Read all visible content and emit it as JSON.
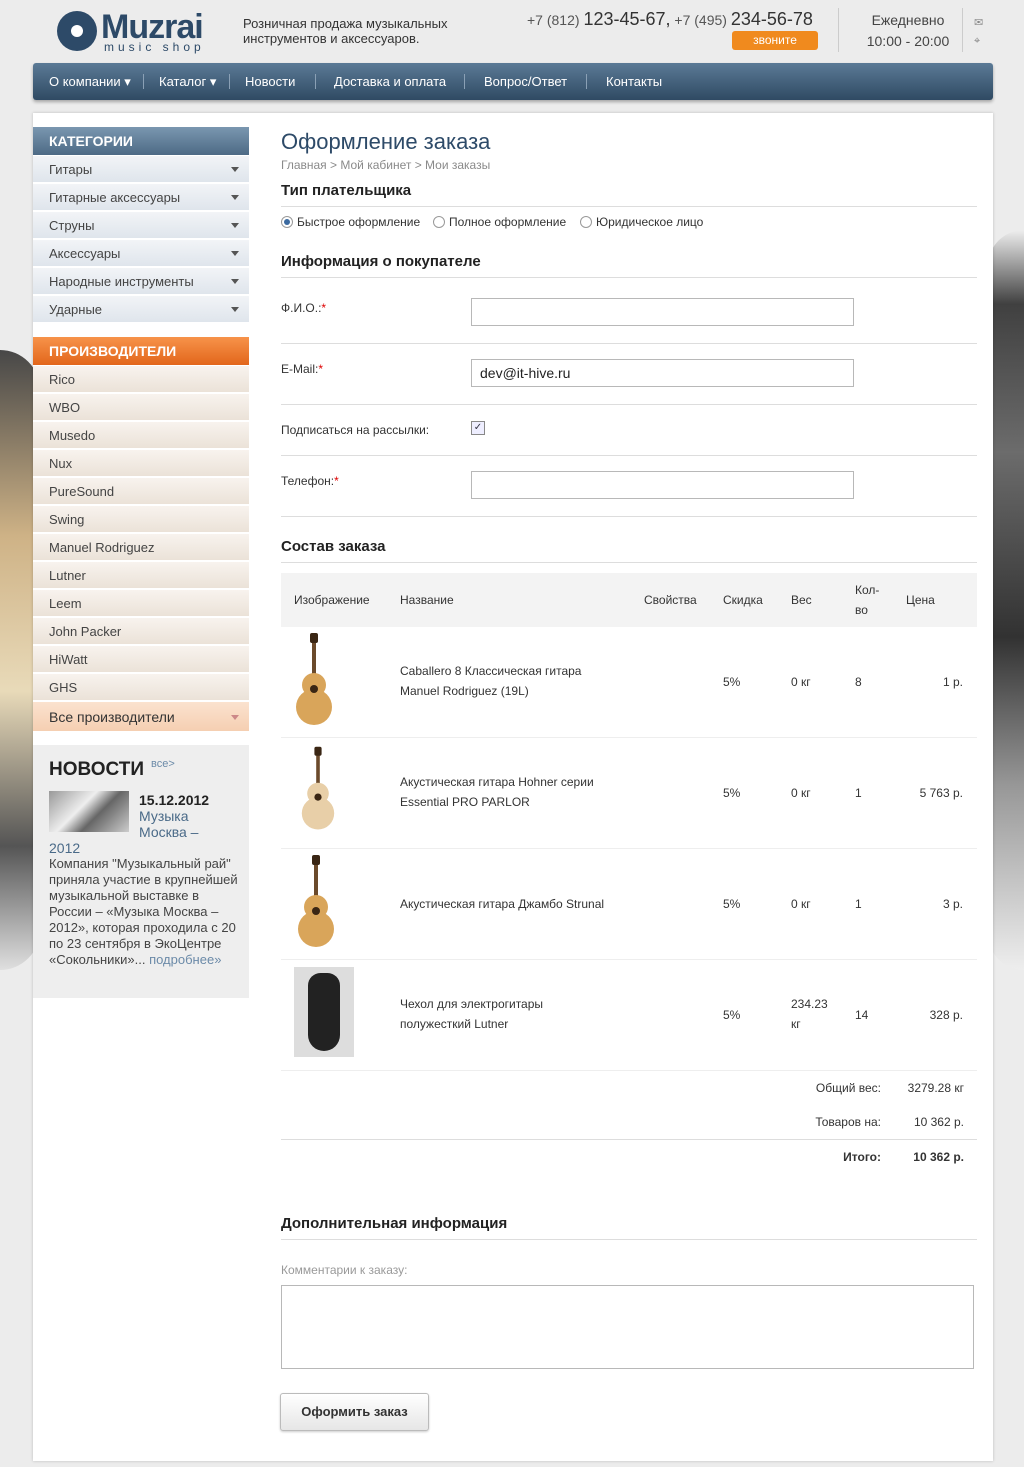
{
  "header": {
    "brand": "Muzrai",
    "brand_sub": "music shop",
    "tagline": "Розничная продажа музыкальных инструментов и аксессуаров.",
    "phone1_prefix": "+7 (812)",
    "phone1": "123-45-67,",
    "phone2_prefix": "+7 (495)",
    "phone2": "234-56-78",
    "call_label": "звоните",
    "hours_title": "Ежедневно",
    "hours_value": "10:00 - 20:00",
    "mail_icon": "✉",
    "map_icon": "⌖"
  },
  "nav": [
    {
      "label": "О компании ▾"
    },
    {
      "label": "Каталог ▾"
    },
    {
      "label": "Новости"
    },
    {
      "label": "Доставка и оплата"
    },
    {
      "label": "Вопрос/Ответ"
    },
    {
      "label": "Контакты"
    }
  ],
  "sidebar": {
    "categories_title": "КАТЕГОРИИ",
    "categories": [
      "Гитары",
      "Гитарные аксессуары",
      "Струны",
      "Аксессуары",
      "Народные инструменты",
      "Ударные"
    ],
    "manufacturers_title": "ПРОИЗВОДИТЕЛИ",
    "manufacturers": [
      "Rico",
      "WBO",
      "Musedo",
      "Nux",
      "PureSound",
      "Swing",
      "Manuel Rodriguez",
      "Lutner",
      "Leem",
      "John Packer",
      "HiWatt",
      "GHS"
    ],
    "all_manufacturers": "Все производители"
  },
  "news": {
    "title": "НОВОСТИ",
    "all": "все>",
    "date": "15.12.2012",
    "headline_part1": "Музыка Москва –",
    "headline_part2": "2012",
    "text": "Компания \"Музыкальный рай\" приняла участие в крупнейшей музыкальной выставке в России – «Музыка Москва – 2012», которая проходила с 20 по 23 сентября в ЭкоЦентре «Сокольники»...",
    "more": "подробнее»"
  },
  "page": {
    "title": "Оформление заказа",
    "breadcrumbs": "Главная > Мой кабинет > Мои заказы"
  },
  "payer": {
    "title": "Тип плательщика",
    "options": [
      "Быстрое оформление",
      "Полное оформление",
      "Юридическое лицо"
    ],
    "selected": "Быстрое оформление"
  },
  "buyer": {
    "title": "Информация о покупателе",
    "fio_label": "Ф.И.О.:",
    "fio_value": "",
    "email_label": "E-Mail:",
    "email_value": "dev@it-hive.ru",
    "subscribe_label": "Подписаться на рассылки:",
    "subscribe_checked": true,
    "phone_label": "Телефон:",
    "phone_value": "",
    "required_mark": "*"
  },
  "order": {
    "title": "Состав заказа",
    "columns": [
      "Изображение",
      "Название",
      "Свойства",
      "Скидка",
      "Вес",
      "Кол-во",
      "Цена"
    ],
    "items": [
      {
        "name": "Caballero 8 Классическая гитара Manuel Rodriguez (19L)",
        "props": "",
        "discount": "5%",
        "weight": "0 кг",
        "qty": "8",
        "price": "1 р.",
        "image": "classical-guitar"
      },
      {
        "name": "Акустическая гитара Hohner серии Essential PRO PARLOR",
        "props": "",
        "discount": "5%",
        "weight": "0 кг",
        "qty": "1",
        "price": "5 763 р.",
        "image": "acoustic-guitar-light"
      },
      {
        "name": "Акустическая гитара Джамбо Strunal",
        "props": "",
        "discount": "5%",
        "weight": "0 кг",
        "qty": "1",
        "price": "3 р.",
        "image": "jumbo-guitar"
      },
      {
        "name": "Чехол для электрогитары полужесткий Lutner",
        "props": "",
        "discount": "5%",
        "weight": "234.23 кг",
        "qty": "14",
        "price": "328 р.",
        "image": "guitar-case"
      }
    ],
    "total_weight_label": "Общий вес:",
    "total_weight": "3279.28 кг",
    "goods_label": "Товаров на:",
    "goods_total": "10 362 р.",
    "total_label": "Итого:",
    "total": "10 362 р."
  },
  "extra": {
    "title": "Дополнительная информация",
    "comment_label": "Комментарии к заказу:",
    "comment_value": "",
    "submit_label": "Оформить заказ"
  }
}
